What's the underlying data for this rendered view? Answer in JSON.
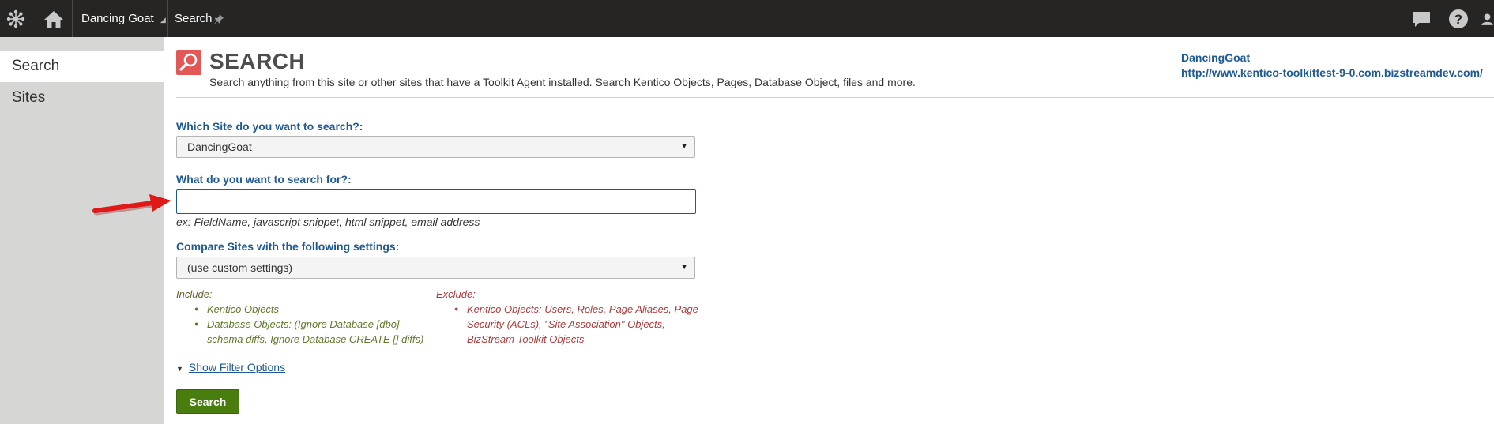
{
  "topbar": {
    "site_name": "Dancing Goat",
    "app_name": "Search",
    "icons": [
      "kentico-logo-icon",
      "home-icon",
      "pin-icon",
      "chat-icon",
      "help-icon",
      "user-icon"
    ]
  },
  "sidebar": {
    "items": [
      {
        "label": "Search",
        "active": true
      },
      {
        "label": "Sites",
        "active": false
      }
    ]
  },
  "header": {
    "title": "SEARCH",
    "description": "Search anything from this site or other sites that have a Toolkit Agent installed. Search Kentico Objects, Pages, Database Object, files and more.",
    "site_name": "DancingGoat",
    "site_url": "http://www.kentico-toolkittest-9-0.com.bizstreamdev.com/"
  },
  "form": {
    "site_label": "Which Site do you want to search?:",
    "site_value": "DancingGoat",
    "query_label": "What do you want to search for?:",
    "query_value": "",
    "query_hint": "ex: FieldName, javascript snippet, html snippet, email address",
    "compare_label": "Compare Sites with the following settings:",
    "compare_value": "(use custom settings)",
    "include_heading": "Include:",
    "include_items": [
      "Kentico Objects",
      "Database Objects: (Ignore Database [dbo] schema diffs, Ignore Database CREATE [] diffs)"
    ],
    "exclude_heading": "Exclude:",
    "exclude_items": [
      "Kentico Objects: Users, Roles, Page Aliases, Page Security (ACLs), \"Site Association\" Objects, BizStream Toolkit Objects"
    ],
    "filter_link": "Show Filter Options",
    "search_button": "Search"
  },
  "colors": {
    "topbar": "#262524",
    "sidebar": "#d6d6d4",
    "accent_blue": "#1e5a96",
    "title_icon": "#e35757",
    "button_green": "#497d0e",
    "include_text": "#5f7a2a",
    "exclude_text": "#b03a3a",
    "annotation_arrow": "#e01818"
  }
}
